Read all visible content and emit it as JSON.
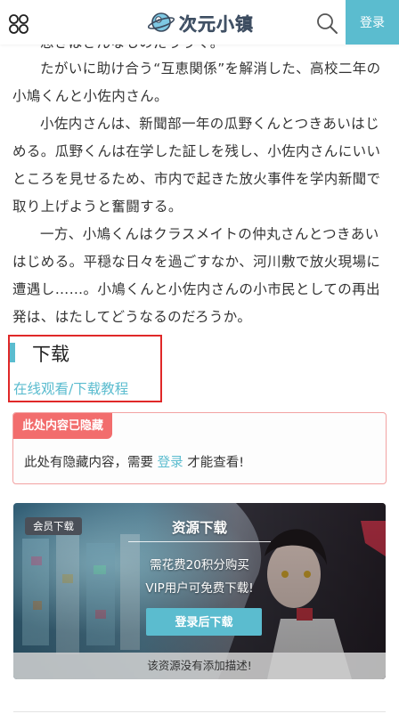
{
  "header": {
    "logo_text": "次元小镇",
    "login_label": "登录",
    "menu_icon": "menu-grid-icon",
    "search_icon": "search-icon"
  },
  "article": {
    "cut_line": "思きはさんなものだううく。",
    "paragraphs": [
      "たがいに助け合う“互恵関係”を解消した、高校二年の小鳩くんと小佐内さん。",
      "小佐内さんは、新聞部一年の瓜野くんとつきあいはじめる。瓜野くんは在学した証しを残し、小佐内さんにいいところを見せるため、市内で起きた放火事件を学内新聞で取り上げようと奮闘する。",
      "一方、小鳩くんはクラスメイトの仲丸さんとつきあいはじめる。平穏な日々を過ごすなか、河川敷で放火現場に遭遇し……。小鳩くんと小佐内さんの小市民としての再出発は、はたしてどうなるのだろうか。"
    ]
  },
  "download": {
    "title": "下载",
    "link_text": "在线观看/下载教程"
  },
  "hidden_notice": {
    "badge": "此处内容已隐藏",
    "text_before": "此处有隐藏内容，需要 ",
    "link": "登录",
    "text_after": " 才能查看!"
  },
  "resource": {
    "badge": "会员下载",
    "title": "资源下载",
    "price": "需花费20积分购买",
    "vip": "VIP用户可免费下载!",
    "button": "登录后下载",
    "description": "该资源没有添加描述!"
  },
  "colors": {
    "accent": "#5bbccf",
    "alert": "#f26d6d",
    "highlight_border": "#e02828"
  }
}
